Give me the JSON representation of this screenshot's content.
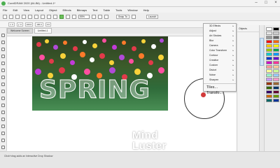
{
  "window": {
    "title": "CorelDRAW 2020 (64-Bit) - Untitled-1*",
    "controls": [
      "minimize",
      "maximize",
      "close"
    ]
  },
  "menubar": [
    "File",
    "Edit",
    "View",
    "Layout",
    "Object",
    "Effects",
    "Bitmaps",
    "Text",
    "Table",
    "Tools",
    "Window",
    "Help"
  ],
  "toolbar": {
    "zoom_value": "55%",
    "snap_label": "Snap To",
    "launch_label": "Launch"
  },
  "propbar": {
    "fields": [
      "x: 0",
      "y: 0",
      "100.0",
      "100.0",
      "0.0"
    ]
  },
  "tabs": [
    {
      "label": "Welcome Screen",
      "active": false
    },
    {
      "label": "Untitled-1",
      "active": true
    }
  ],
  "canvas": {
    "headline_text": "SPRING"
  },
  "menu": {
    "items": [
      {
        "label": "3D Effects",
        "arrow": true
      },
      {
        "label": "Adjust",
        "arrow": true
      },
      {
        "label": "Art Strokes",
        "arrow": true
      },
      {
        "label": "Blur",
        "arrow": true
      },
      {
        "label": "Camera",
        "arrow": true
      },
      {
        "label": "Color Transform",
        "arrow": true
      },
      {
        "label": "Contour",
        "arrow": true
      },
      {
        "label": "Creative",
        "arrow": true
      },
      {
        "label": "Custom",
        "arrow": true
      },
      {
        "label": "Distort",
        "arrow": true
      },
      {
        "label": "Noise",
        "arrow": true
      },
      {
        "label": "Sharpen",
        "arrow": true
      },
      {
        "label": "Texture",
        "arrow": true
      }
    ],
    "big_items": [
      "Tiles...",
      "Transfo..."
    ]
  },
  "docker": {
    "header": "Objects",
    "tab_label": "Properties"
  },
  "palette": {
    "colors": [
      "#ffffff",
      "#000000",
      "#e6e6e6",
      "#cccccc",
      "#999999",
      "#666666",
      "#ff0000",
      "#ff6600",
      "#ffcc00",
      "#ffff00",
      "#99cc00",
      "#00a651",
      "#00cccc",
      "#0099ff",
      "#0033cc",
      "#6600cc",
      "#cc00cc",
      "#ff3399",
      "#ff9999",
      "#ffcc99",
      "#ffff99",
      "#ccff99",
      "#99ffcc",
      "#99ccff",
      "#cc99ff",
      "#ff99cc",
      "#993300",
      "#996633",
      "#336600",
      "#003366",
      "#330066",
      "#660033",
      "#cc6600",
      "#669900",
      "#006666",
      "#003399"
    ]
  },
  "status": {
    "text": "Click+drag adds an Interactive Drop Shadow"
  },
  "watermark": {
    "line1": "Mind",
    "line2": "Luster"
  }
}
